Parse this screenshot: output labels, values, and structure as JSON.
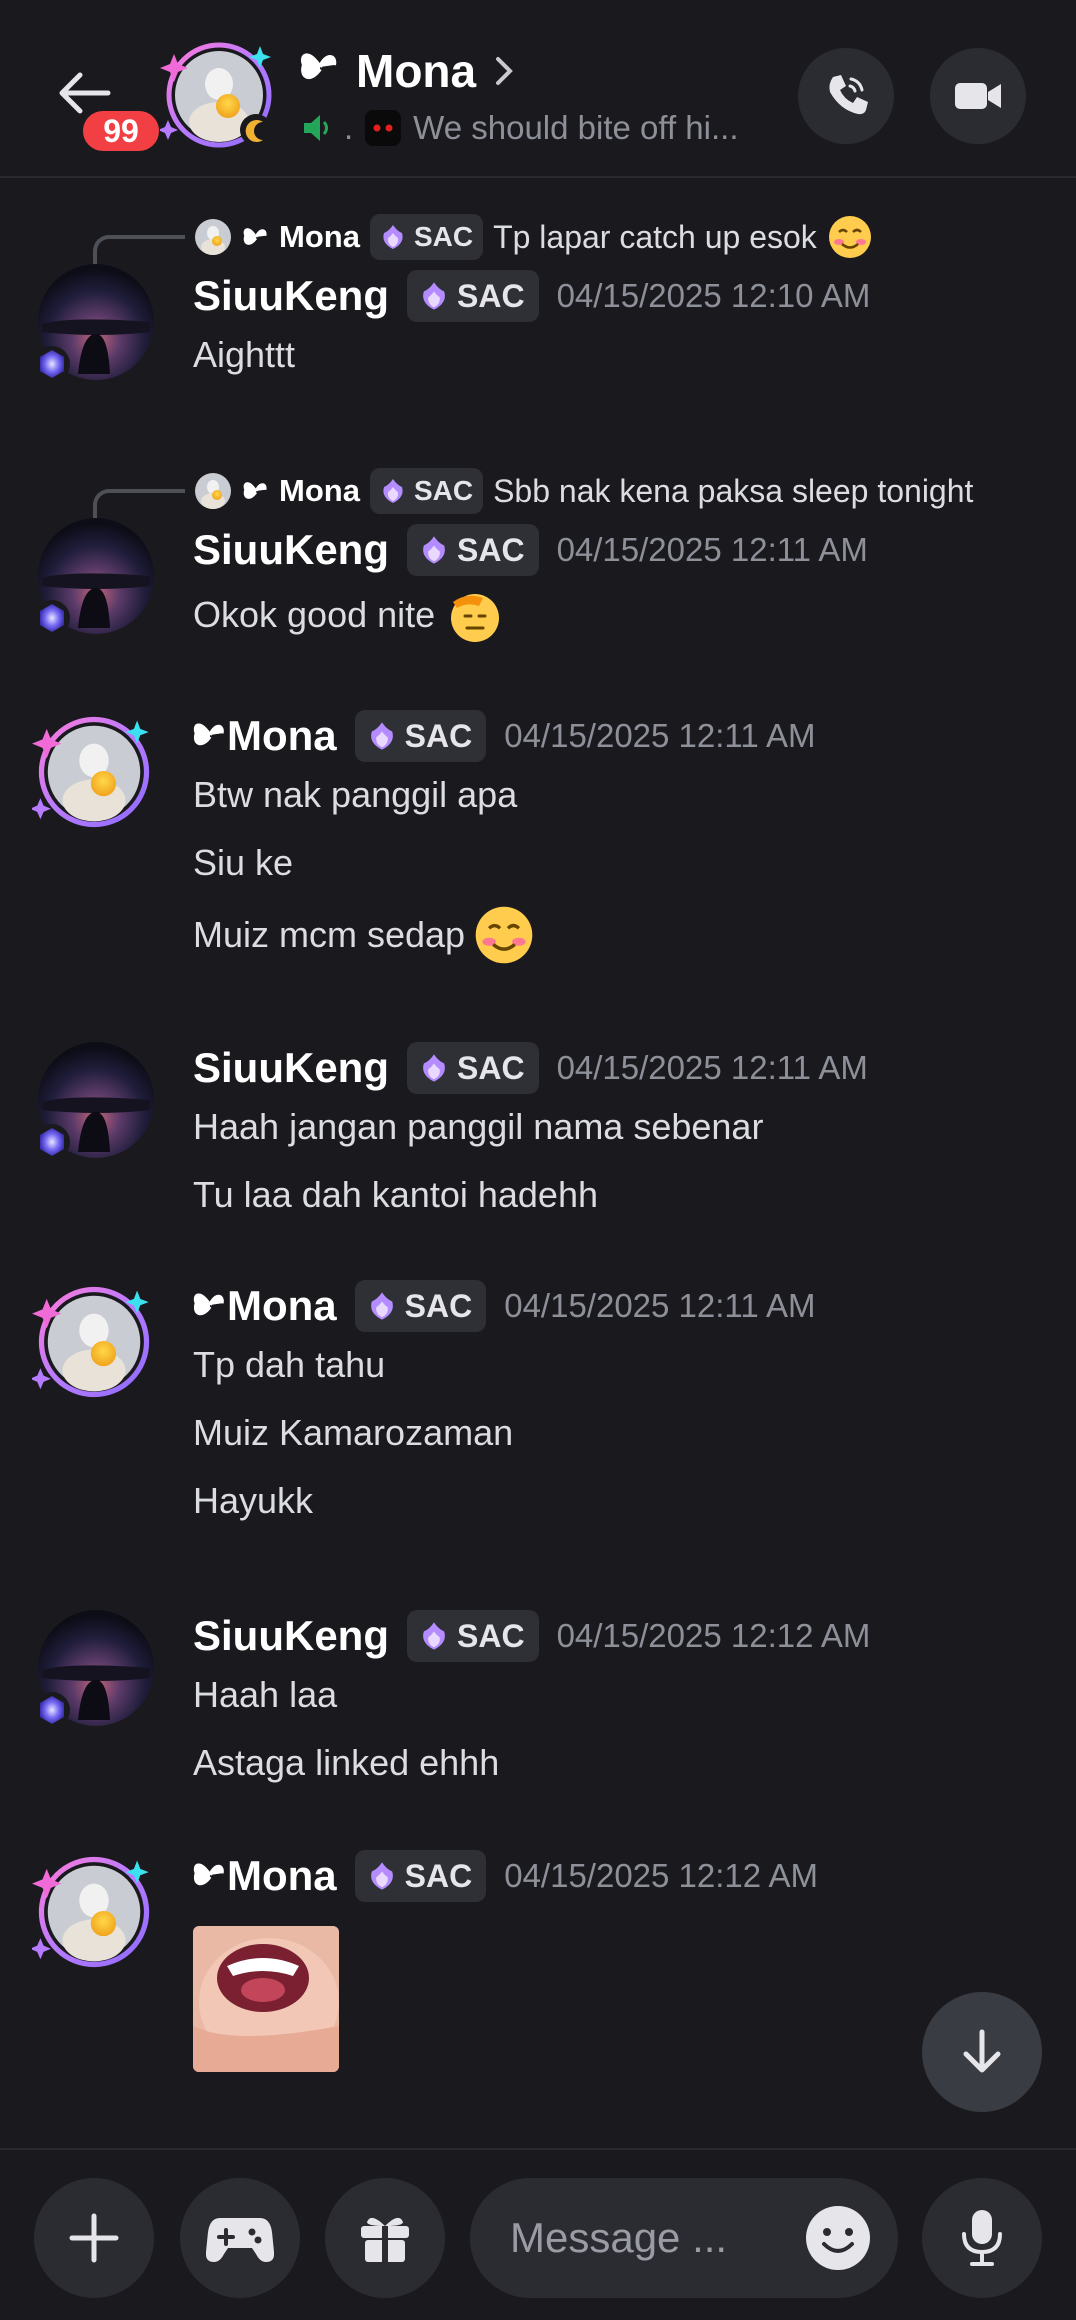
{
  "header": {
    "unread_count": "99",
    "channel_name": "Mona",
    "status_dot": ".",
    "status_text": "We should bite off hi..."
  },
  "messages": [
    {
      "reply": {
        "author": "Mona",
        "tag": "SAC",
        "text": "Tp lapar catch up esok"
      },
      "author": "SiuuKeng",
      "tag": "SAC",
      "timestamp": "04/15/2025 12:10 AM",
      "lines": [
        "Aighttt"
      ]
    },
    {
      "reply": {
        "author": "Mona",
        "tag": "SAC",
        "text": "Sbb nak kena paksa sleep tonight"
      },
      "author": "SiuuKeng",
      "tag": "SAC",
      "timestamp": "04/15/2025 12:11 AM",
      "lines": [
        "Okok good nite"
      ]
    },
    {
      "author": "Mona",
      "tag": "SAC",
      "timestamp": "04/15/2025 12:11 AM",
      "lines": [
        "Btw nak panggil apa",
        "Siu ke",
        "Muiz mcm sedap"
      ]
    },
    {
      "author": "SiuuKeng",
      "tag": "SAC",
      "timestamp": "04/15/2025 12:11 AM",
      "lines": [
        "Haah jangan panggil nama sebenar",
        "Tu laa dah kantoi hadehh"
      ]
    },
    {
      "author": "Mona",
      "tag": "SAC",
      "timestamp": "04/15/2025 12:11 AM",
      "lines": [
        "Tp dah tahu",
        "Muiz Kamarozaman",
        "Hayukk"
      ]
    },
    {
      "author": "SiuuKeng",
      "tag": "SAC",
      "timestamp": "04/15/2025 12:12 AM",
      "lines": [
        "Haah laa",
        "Astaga linked ehhh"
      ]
    },
    {
      "author": "Mona",
      "tag": "SAC",
      "timestamp": "04/15/2025 12:12 AM",
      "lines": []
    }
  ],
  "composer": {
    "placeholder": "Message ..."
  },
  "icons": {
    "back": "arrow-left-icon",
    "call": "phone-icon",
    "video": "video-camera-icon",
    "add": "plus-icon",
    "games": "gamepad-icon",
    "gift": "gift-icon",
    "emoji": "smiley-icon",
    "mic": "microphone-icon",
    "jump": "arrow-down-icon"
  },
  "colors": {
    "background": "#1a1a1e",
    "badge": "#f23f43",
    "surface": "#2b2c32"
  }
}
